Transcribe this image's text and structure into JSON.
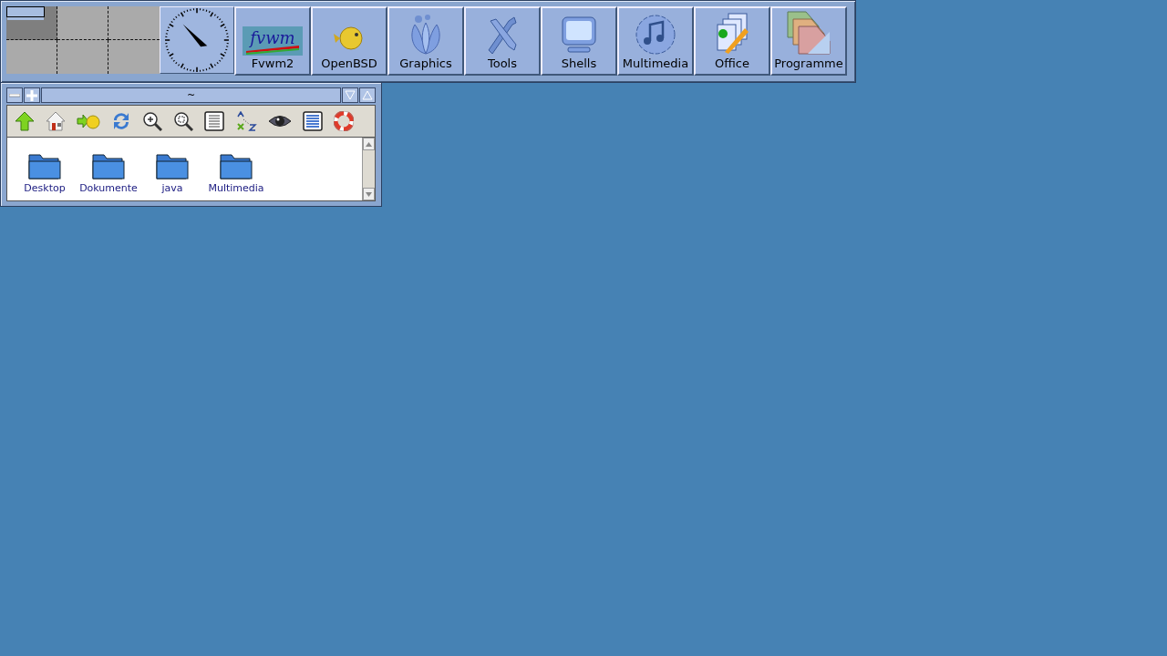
{
  "pager": {
    "desks": [
      {
        "selected": true
      },
      {
        "selected": false
      },
      {
        "selected": false
      },
      {
        "selected": false
      },
      {
        "selected": false
      },
      {
        "selected": false
      }
    ]
  },
  "launchers": [
    {
      "kind": "fvwm",
      "label": "Fvwm2"
    },
    {
      "kind": "fish",
      "label": "OpenBSD"
    },
    {
      "kind": "flower",
      "label": "Graphics"
    },
    {
      "kind": "tools",
      "label": "Tools"
    },
    {
      "kind": "monitor",
      "label": "Shells"
    },
    {
      "kind": "music",
      "label": "Multimedia"
    },
    {
      "kind": "docs",
      "label": "Office"
    },
    {
      "kind": "folders",
      "label": "Programme"
    }
  ],
  "file_window": {
    "title": "~",
    "toolbar": [
      {
        "kind": "up"
      },
      {
        "kind": "home"
      },
      {
        "kind": "go"
      },
      {
        "kind": "reload"
      },
      {
        "kind": "zoom-in"
      },
      {
        "kind": "zoom-fit"
      },
      {
        "kind": "list"
      },
      {
        "kind": "sort"
      },
      {
        "kind": "eye"
      },
      {
        "kind": "details"
      },
      {
        "kind": "help"
      }
    ],
    "folders": [
      {
        "name": "Desktop"
      },
      {
        "name": "Dokumente"
      },
      {
        "name": "java"
      },
      {
        "name": "Multimedia"
      }
    ]
  }
}
